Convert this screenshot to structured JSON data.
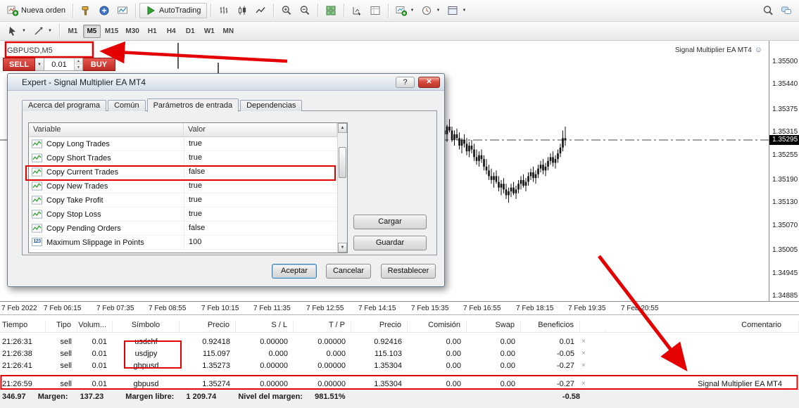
{
  "colors": {
    "annotation_red": "#e40000",
    "sell_buy_red": "#c02c25",
    "price_tag_bg": "#000000",
    "autotrading_green": "#35a435"
  },
  "icons": {
    "caret_down": "▼",
    "caret_up": "▲",
    "smiley": "☺"
  },
  "toolbar_top": {
    "new_order_label": "Nueva orden",
    "autotrading_label": "AutoTrading"
  },
  "toolbar_tf": {
    "timeframes": [
      "M1",
      "M5",
      "M15",
      "M30",
      "H1",
      "H4",
      "D1",
      "W1",
      "MN"
    ],
    "active": "M5"
  },
  "chart": {
    "symbol_label": "GBPUSD,M5",
    "ea_label": "Signal Multiplier EA MT4",
    "one_click": {
      "sell_label": "SELL",
      "volume": "0.01",
      "buy_label": "BUY"
    },
    "price_axis": [
      "1.35500",
      "1.35440",
      "1.35375",
      "1.35315",
      "1.35255",
      "1.35190",
      "1.35130",
      "1.35070",
      "1.35005",
      "1.34945",
      "1.34885"
    ],
    "price_tag": "1.35295",
    "time_axis": [
      "7 Feb 2022",
      "7 Feb 06:15",
      "7 Feb 07:35",
      "7 Feb 08:55",
      "7 Feb 10:15",
      "7 Feb 11:35",
      "7 Feb 12:55",
      "7 Feb 14:15",
      "7 Feb 15:35",
      "7 Feb 16:55",
      "7 Feb 18:15",
      "7 Feb 19:35",
      "7 Feb 20:55"
    ],
    "candles": [
      [
        135300,
        135345,
        135285,
        135320
      ],
      [
        135320,
        135340,
        135300,
        135310
      ],
      [
        135310,
        135335,
        135290,
        135330
      ],
      [
        135330,
        135350,
        135315,
        135320
      ],
      [
        135320,
        135330,
        135290,
        135295
      ],
      [
        135295,
        135320,
        135280,
        135310
      ],
      [
        135310,
        135325,
        135295,
        135300
      ],
      [
        135300,
        135315,
        135270,
        135280
      ],
      [
        135280,
        135300,
        135260,
        135295
      ],
      [
        135295,
        135310,
        135275,
        135285
      ],
      [
        135285,
        135300,
        135255,
        135265
      ],
      [
        135265,
        135290,
        135250,
        135280
      ],
      [
        135280,
        135295,
        135260,
        135270
      ],
      [
        135270,
        135285,
        135240,
        135250
      ],
      [
        135250,
        135270,
        135230,
        135240
      ],
      [
        135240,
        135265,
        135225,
        135255
      ],
      [
        135255,
        135270,
        135235,
        135245
      ],
      [
        135245,
        135255,
        135215,
        135225
      ],
      [
        135225,
        135245,
        135205,
        135215
      ],
      [
        135215,
        135230,
        135190,
        135200
      ],
      [
        135200,
        135220,
        135180,
        135190
      ],
      [
        135190,
        135210,
        135170,
        135200
      ],
      [
        135200,
        135215,
        135180,
        135185
      ],
      [
        135185,
        135200,
        135160,
        135170
      ],
      [
        135170,
        135190,
        135150,
        135180
      ],
      [
        135180,
        135195,
        135155,
        135165
      ],
      [
        135165,
        135180,
        135140,
        135150
      ],
      [
        135150,
        135170,
        135130,
        135160
      ],
      [
        135160,
        135180,
        135145,
        135170
      ],
      [
        135170,
        135185,
        135150,
        135155
      ],
      [
        135155,
        135175,
        135140,
        135165
      ],
      [
        135165,
        135190,
        135155,
        135180
      ],
      [
        135180,
        135200,
        135165,
        135190
      ],
      [
        135190,
        135205,
        135170,
        135175
      ],
      [
        135175,
        135195,
        135160,
        135185
      ],
      [
        135185,
        135210,
        135175,
        135200
      ],
      [
        135200,
        135220,
        135190,
        135210
      ],
      [
        135210,
        135225,
        135185,
        135195
      ],
      [
        135195,
        135215,
        135180,
        135205
      ],
      [
        135205,
        135230,
        135195,
        135220
      ],
      [
        135220,
        135240,
        135210,
        135230
      ],
      [
        135230,
        135245,
        135205,
        135215
      ],
      [
        135215,
        135235,
        135200,
        135225
      ],
      [
        135225,
        135250,
        135215,
        135240
      ],
      [
        135240,
        135260,
        135230,
        135250
      ],
      [
        135250,
        135265,
        135225,
        135235
      ],
      [
        135235,
        135255,
        135220,
        135245
      ],
      [
        135245,
        135270,
        135235,
        135260
      ],
      [
        135260,
        135285,
        135250,
        135275
      ],
      [
        135275,
        135320,
        135265,
        135300
      ],
      [
        135300,
        135330,
        135280,
        135295
      ]
    ],
    "spikes": [
      [
        253,
        135550,
        135482
      ],
      [
        310,
        135498,
        135461
      ]
    ]
  },
  "dialog": {
    "title": "Expert - Signal Multiplier EA MT4",
    "help_glyph": "?",
    "close_glyph": "✕",
    "tabs": [
      "Acerca del programa",
      "Común",
      "Parámetros de entrada",
      "Dependencias"
    ],
    "active_tab": "Parámetros de entrada",
    "table_headers": [
      "Variable",
      "Valor"
    ],
    "params": [
      [
        "chart",
        "Copy Long Trades",
        "true"
      ],
      [
        "chart",
        "Copy Short Trades",
        "true"
      ],
      [
        "chart",
        "Copy Current Trades",
        "false"
      ],
      [
        "chart",
        "Copy New Trades",
        "true"
      ],
      [
        "chart",
        "Copy Take Profit",
        "true"
      ],
      [
        "chart",
        "Copy Stop Loss",
        "true"
      ],
      [
        "chart",
        "Copy Pending Orders",
        "false"
      ],
      [
        "123",
        "Maximum Slippage in Points",
        "100"
      ]
    ],
    "buttons": {
      "load": "Cargar",
      "save": "Guardar",
      "ok": "Aceptar",
      "cancel": "Cancelar",
      "reset": "Restablecer"
    }
  },
  "terminal": {
    "headers": [
      "Tiempo",
      "Tipo",
      "Volum...",
      "Símbolo",
      "Precio",
      "S / L",
      "T / P",
      "Precio",
      "Comisión",
      "Swap",
      "Beneficios",
      "",
      "Comentario"
    ],
    "rows": [
      [
        "21:26:31",
        "sell",
        "0.01",
        "usdchf",
        "0.92418",
        "0.00000",
        "0.00000",
        "0.92416",
        "0.00",
        "0.00",
        "0.01",
        "×",
        ""
      ],
      [
        "21:26:38",
        "sell",
        "0.01",
        "usdjpy",
        "115.097",
        "0.000",
        "0.000",
        "115.103",
        "0.00",
        "0.00",
        "-0.05",
        "×",
        ""
      ],
      [
        "21:26:41",
        "sell",
        "0.01",
        "gbpusd",
        "1.35273",
        "0.00000",
        "0.00000",
        "1.35304",
        "0.00",
        "0.00",
        "-0.27",
        "×",
        ""
      ],
      [
        "21:26:59",
        "sell",
        "0.01",
        "gbpusd",
        "1.35274",
        "0.00000",
        "0.00000",
        "1.35304",
        "0.00",
        "0.00",
        "-0.27",
        "×",
        "Signal Multiplier EA MT4"
      ]
    ],
    "status": {
      "balance": "346.97",
      "margin_label": "Margen:",
      "margin_value": "137.23",
      "free_label": "Margen libre:",
      "free_value": "1 209.74",
      "level_label": "Nivel del margen:",
      "level_value": "981.51%",
      "profit": "-0.58"
    }
  }
}
